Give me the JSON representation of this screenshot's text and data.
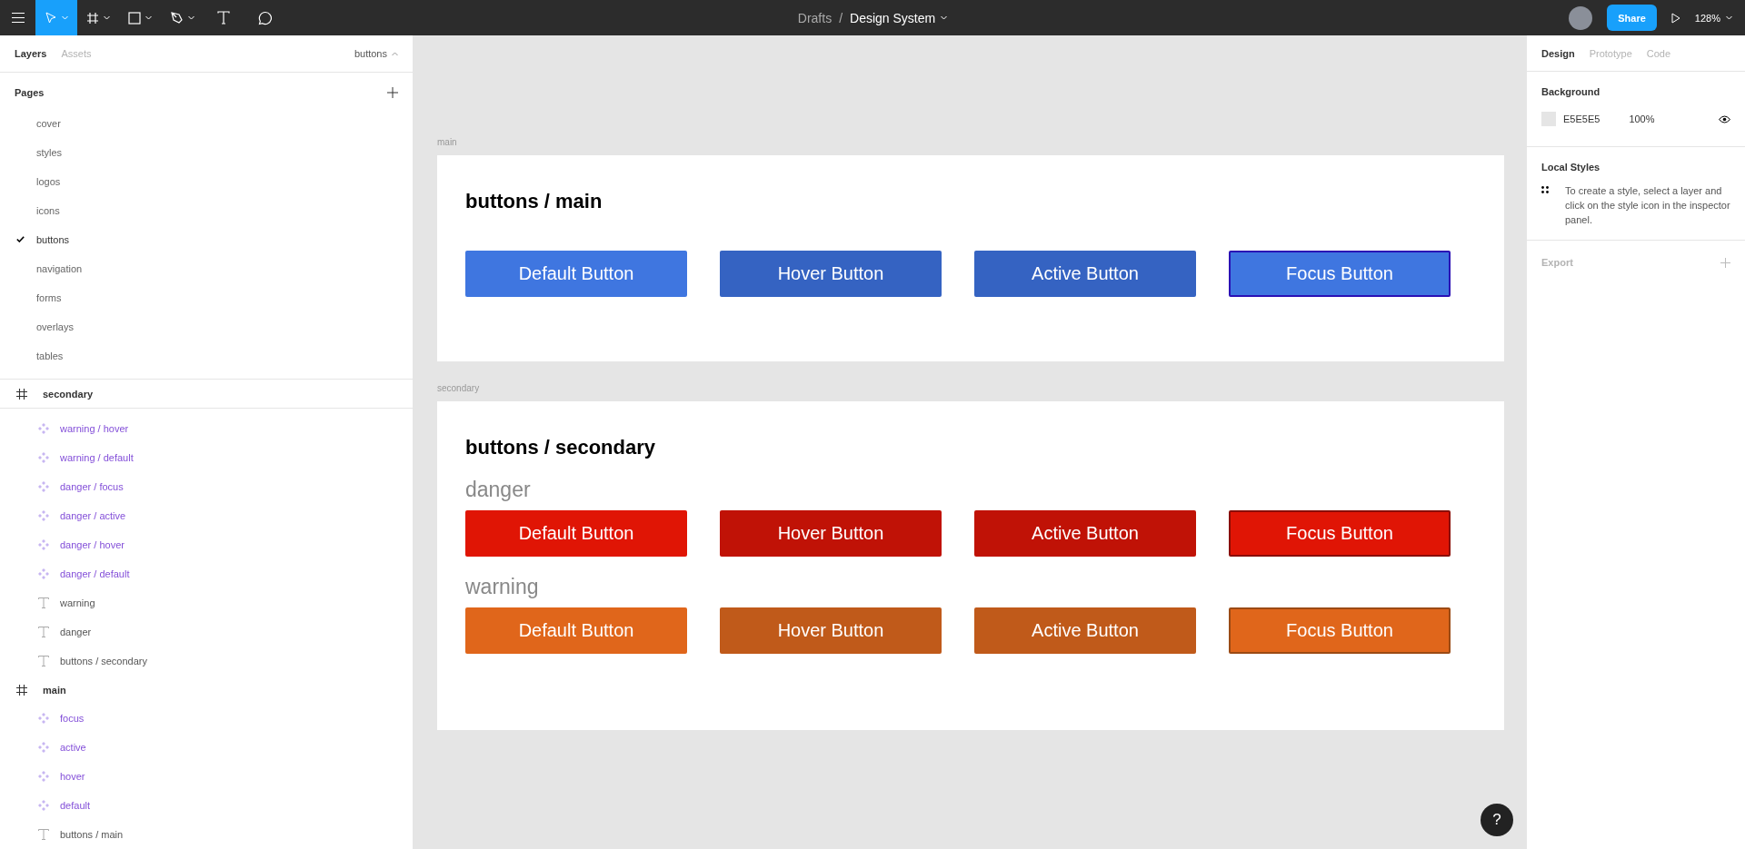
{
  "toolbar": {
    "tools": [
      {
        "kind": "move",
        "selected": true,
        "dropdown": true
      },
      {
        "kind": "frame",
        "selected": false,
        "dropdown": true
      },
      {
        "kind": "shape",
        "selected": false,
        "dropdown": true
      },
      {
        "kind": "pen",
        "selected": false,
        "dropdown": true
      },
      {
        "kind": "text",
        "selected": false,
        "dropdown": false
      },
      {
        "kind": "comment",
        "selected": false,
        "dropdown": false
      }
    ],
    "breadcrumb": {
      "folder": "Drafts",
      "separator": "/",
      "file": "Design System"
    },
    "share": "Share",
    "zoom": "128%"
  },
  "left_panel": {
    "tabs": [
      {
        "label": "Layers",
        "selected": true
      },
      {
        "label": "Assets",
        "selected": false
      }
    ],
    "page_picker": "buttons",
    "pages": {
      "title": "Pages",
      "items": [
        {
          "label": "cover",
          "selected": false
        },
        {
          "label": "styles",
          "selected": false
        },
        {
          "label": "logos",
          "selected": false
        },
        {
          "label": "icons",
          "selected": false
        },
        {
          "label": "buttons",
          "selected": true
        },
        {
          "label": "navigation",
          "selected": false
        },
        {
          "label": "forms",
          "selected": false
        },
        {
          "label": "overlays",
          "selected": false
        },
        {
          "label": "tables",
          "selected": false
        }
      ]
    },
    "layers": [
      {
        "kind": "frame",
        "label": "secondary",
        "children": [
          {
            "kind": "component",
            "label": "warning / hover"
          },
          {
            "kind": "component",
            "label": "warning / default"
          },
          {
            "kind": "component",
            "label": "danger / focus"
          },
          {
            "kind": "component",
            "label": "danger / active"
          },
          {
            "kind": "component",
            "label": "danger / hover"
          },
          {
            "kind": "component",
            "label": "danger / default"
          },
          {
            "kind": "text",
            "label": "warning"
          },
          {
            "kind": "text",
            "label": "danger"
          },
          {
            "kind": "text",
            "label": "buttons / secondary"
          }
        ]
      },
      {
        "kind": "frame",
        "label": "main",
        "children": [
          {
            "kind": "component",
            "label": "focus"
          },
          {
            "kind": "component",
            "label": "active"
          },
          {
            "kind": "component",
            "label": "hover"
          },
          {
            "kind": "component",
            "label": "default"
          },
          {
            "kind": "text",
            "label": "buttons / main"
          }
        ]
      }
    ]
  },
  "canvas": {
    "frames": [
      {
        "label": "main",
        "title": "buttons / main",
        "groups": [
          {
            "kind": "primary",
            "buttons": [
              {
                "label": "Default Button",
                "kind": "default"
              },
              {
                "label": "Hover Button",
                "kind": "hover"
              },
              {
                "label": "Active Button",
                "kind": "active"
              },
              {
                "label": "Focus Button",
                "kind": "focus"
              }
            ]
          }
        ]
      },
      {
        "label": "secondary",
        "title": "buttons / secondary",
        "groups": [
          {
            "kind": "danger",
            "heading": "danger",
            "buttons": [
              {
                "label": "Default Button",
                "kind": "default"
              },
              {
                "label": "Hover Button",
                "kind": "hover"
              },
              {
                "label": "Active Button",
                "kind": "active"
              },
              {
                "label": "Focus Button",
                "kind": "focus"
              }
            ]
          },
          {
            "kind": "warning",
            "heading": "warning",
            "buttons": [
              {
                "label": "Default Button",
                "kind": "default"
              },
              {
                "label": "Hover Button",
                "kind": "hover"
              },
              {
                "label": "Active Button",
                "kind": "active"
              },
              {
                "label": "Focus Button",
                "kind": "focus"
              }
            ]
          }
        ]
      }
    ],
    "help": "?"
  },
  "right_panel": {
    "tabs": [
      {
        "label": "Design",
        "selected": true
      },
      {
        "label": "Prototype",
        "selected": false
      },
      {
        "label": "Code",
        "selected": false
      }
    ],
    "background": {
      "title": "Background",
      "hex": "E5E5E5",
      "opacity": "100%"
    },
    "local_styles": {
      "title": "Local Styles",
      "hint": "To create a style, select a layer and click on the style icon in the inspector panel."
    },
    "export": {
      "title": "Export"
    }
  }
}
